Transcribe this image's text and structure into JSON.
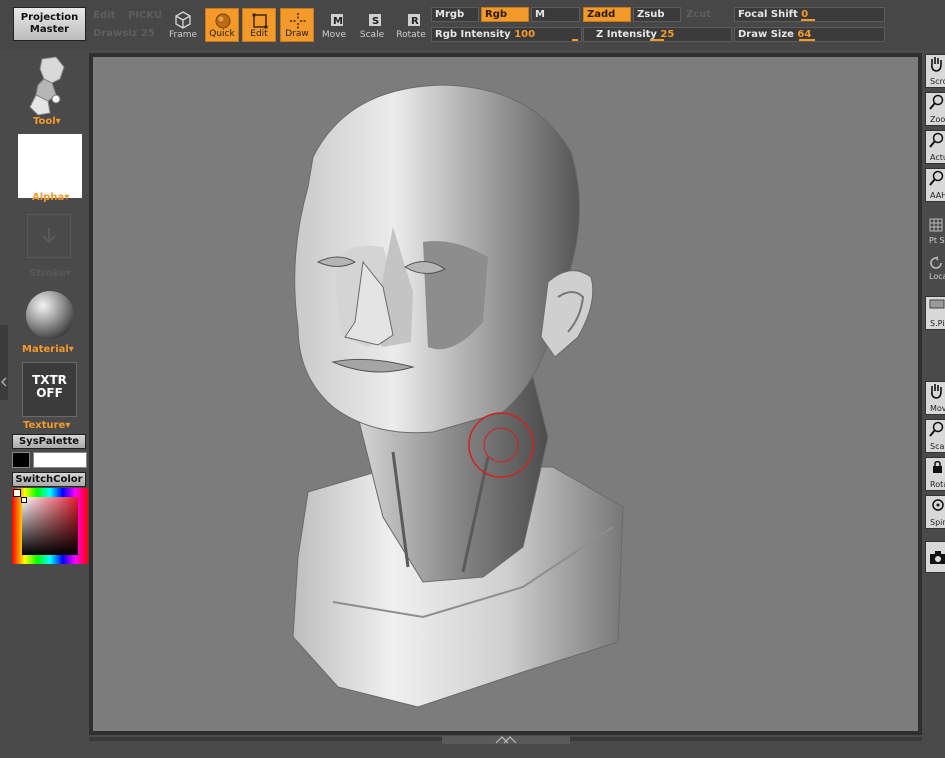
{
  "toolbar": {
    "projection_master": "Projection Master",
    "edit_ghost": "Edit",
    "pickup_ghost": "PICKU",
    "drawsize_ghost": "Drawsiz 25",
    "zcut_ghost": "Zcut",
    "frame": "Frame",
    "quick": "Quick",
    "edit": "Edit",
    "draw": "Draw",
    "move": "Move",
    "scale": "Scale",
    "rotate": "Rotate",
    "mrgb": "Mrgb",
    "rgb": "Rgb",
    "m": "M",
    "zadd": "Zadd",
    "zsub": "Zsub",
    "rgb_intensity_label": "Rgb Intensity",
    "rgb_intensity_value": "100",
    "z_intensity_label": "Z Intensity",
    "z_intensity_value": "25",
    "focal_shift_label": "Focal Shift",
    "focal_shift_value": "0",
    "draw_size_label": "Draw Size",
    "draw_size_value": "64"
  },
  "left": {
    "tool": "Tool",
    "alpha": "Alpha",
    "stroke": "Stroke",
    "material": "Material",
    "texture_line1": "TXTR",
    "texture_line2": "OFF",
    "texture": "Texture",
    "syspalette": "SysPalette",
    "switchcolor": "SwitchColor"
  },
  "right": {
    "scroll": "Scroll",
    "zoom": "Zoom",
    "actual": "Actual",
    "aahalf": "AAHalf",
    "ptsel": "Pt Sel",
    "local": "Local",
    "spix": "S.Pix",
    "move": "Move",
    "scale": "Scale",
    "rotate": "Rotate",
    "spin": "Spin"
  },
  "colors": {
    "accent": "#f39a2b",
    "canvas": "#7c7c7c",
    "brush_cursor": "#d42020"
  }
}
